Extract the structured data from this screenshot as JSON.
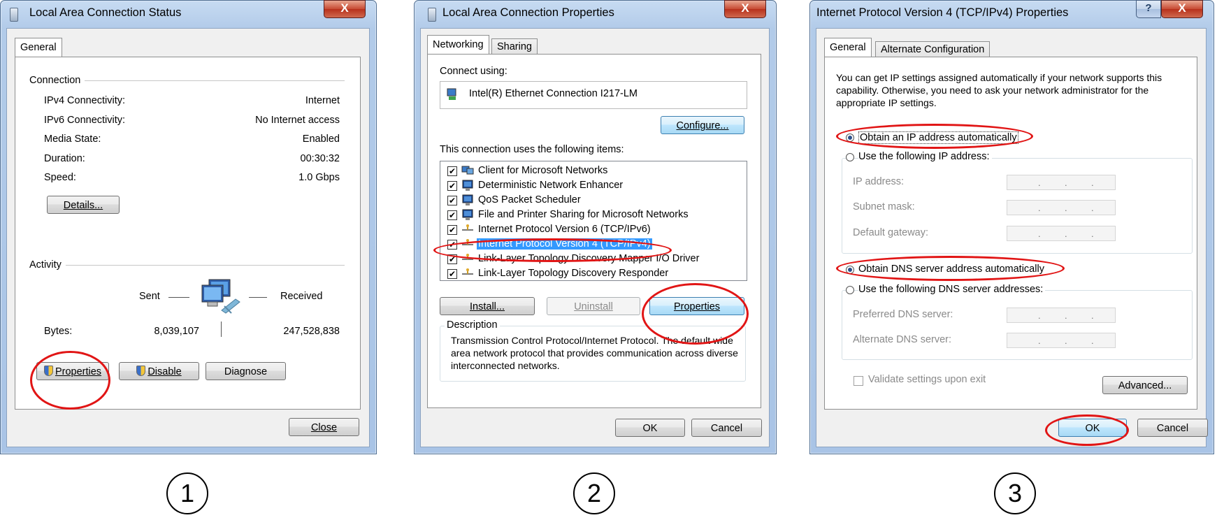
{
  "dialog1": {
    "title": "Local Area Connection Status",
    "tab": "General",
    "connection_label": "Connection",
    "rows": [
      {
        "label": "IPv4 Connectivity:",
        "value": "Internet"
      },
      {
        "label": "IPv6 Connectivity:",
        "value": "No Internet access"
      },
      {
        "label": "Media State:",
        "value": "Enabled"
      },
      {
        "label": "Duration:",
        "value": "00:30:32"
      },
      {
        "label": "Speed:",
        "value": "1.0 Gbps"
      }
    ],
    "details_button": "Details...",
    "activity_label": "Activity",
    "sent_label": "Sent",
    "received_label": "Received",
    "bytes_label": "Bytes:",
    "bytes_sent": "8,039,107",
    "bytes_received": "247,528,838",
    "properties_button": "Properties",
    "disable_button": "Disable",
    "diagnose_button": "Diagnose",
    "close_button": "Close",
    "close_glyph": "X"
  },
  "dialog2": {
    "title": "Local Area Connection Properties",
    "tabs": [
      "Networking",
      "Sharing"
    ],
    "connect_using_label": "Connect using:",
    "adapter_name": "Intel(R) Ethernet Connection I217-LM",
    "configure_button": "Configure...",
    "items_label": "This connection uses the following items:",
    "items": [
      {
        "label": "Client for Microsoft Networks",
        "checked": true,
        "icon": "network-client-icon"
      },
      {
        "label": "Deterministic Network Enhancer",
        "checked": true,
        "icon": "network-service-icon"
      },
      {
        "label": "QoS Packet Scheduler",
        "checked": true,
        "icon": "network-service-icon"
      },
      {
        "label": "File and Printer Sharing for Microsoft Networks",
        "checked": true,
        "icon": "network-service-icon"
      },
      {
        "label": "Internet Protocol Version 6 (TCP/IPv6)",
        "checked": true,
        "icon": "protocol-icon"
      },
      {
        "label": "Internet Protocol Version 4 (TCP/IPv4)",
        "checked": true,
        "icon": "protocol-icon",
        "selected": true
      },
      {
        "label": "Link-Layer Topology Discovery Mapper I/O Driver",
        "checked": true,
        "icon": "protocol-icon"
      },
      {
        "label": "Link-Layer Topology Discovery Responder",
        "checked": true,
        "icon": "protocol-icon"
      }
    ],
    "install_button": "Install...",
    "uninstall_button": "Uninstall",
    "properties_button": "Properties",
    "description_label": "Description",
    "description_text": "Transmission Control Protocol/Internet Protocol. The default wide area network protocol that provides communication across diverse interconnected networks.",
    "ok_button": "OK",
    "cancel_button": "Cancel",
    "close_glyph": "X"
  },
  "dialog3": {
    "title": "Internet Protocol Version 4 (TCP/IPv4) Properties",
    "tabs": [
      "General",
      "Alternate Configuration"
    ],
    "intro_text": "You can get IP settings assigned automatically if your network supports this capability. Otherwise, you need to ask your network administrator for the appropriate IP settings.",
    "obtain_ip_auto": "Obtain an IP address automatically",
    "use_following_ip": "Use the following IP address:",
    "ip_address_label": "IP address:",
    "subnet_mask_label": "Subnet mask:",
    "default_gateway_label": "Default gateway:",
    "obtain_dns_auto": "Obtain DNS server address automatically",
    "use_following_dns": "Use the following DNS server addresses:",
    "preferred_dns_label": "Preferred DNS server:",
    "alternate_dns_label": "Alternate DNS server:",
    "validate_label": "Validate settings upon exit",
    "advanced_button": "Advanced...",
    "ok_button": "OK",
    "cancel_button": "Cancel",
    "ip_dots": ".",
    "help_glyph": "?",
    "close_glyph": "X"
  },
  "step_numbers": [
    "1",
    "2",
    "3"
  ],
  "colors": {
    "highlight_red": "#e11515",
    "selection_blue": "#3399ff",
    "titlebar": "#b9d1ea"
  }
}
